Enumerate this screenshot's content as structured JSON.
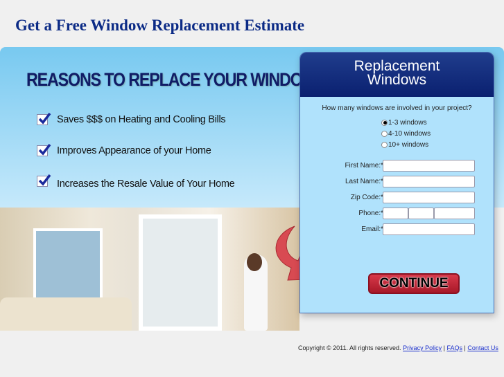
{
  "header": {
    "title": "Get a Free Window Replacement Estimate"
  },
  "banner": {
    "heading": "REASONS TO REPLACE YOUR WINDOWS",
    "reasons": [
      "Saves $$$ on Heating and Cooling Bills",
      "Improves Appearance of your Home",
      "Increases the Resale Value of Your Home"
    ]
  },
  "form": {
    "title_line1": "Replacement",
    "title_line2": "Windows",
    "question": "How many windows are involved in your project?",
    "options": [
      {
        "label": "1-3 windows",
        "selected": true
      },
      {
        "label": "4-10 windows",
        "selected": false
      },
      {
        "label": "10+ windows",
        "selected": false
      }
    ],
    "fields": {
      "first_name": "First Name:*",
      "last_name": "Last Name:*",
      "zip": "Zip Code:*",
      "phone": "Phone:*",
      "email": "Email:*"
    },
    "continue_label": "CONTINUE"
  },
  "footer": {
    "copyright": "Copyright © 2011. All rights reserved.",
    "privacy": "Privacy Policy",
    "faqs": "FAQs",
    "contact": "Contact Us",
    "sep": "|"
  }
}
